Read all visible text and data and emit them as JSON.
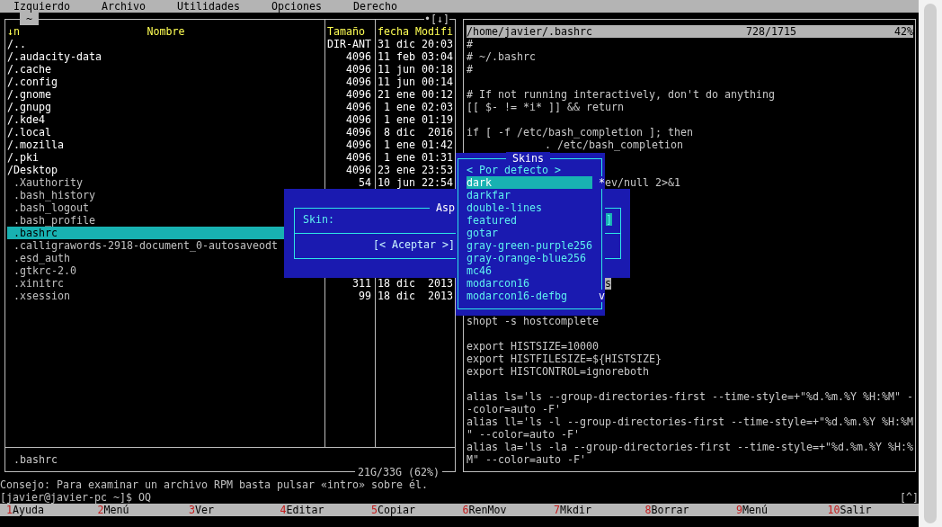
{
  "menu_bar": [
    "Izquierdo",
    "Archivo",
    "Utilidades",
    "Opciones",
    "Derecho"
  ],
  "left_panel": {
    "title": "~",
    "corner": "•[↓]",
    "sort_indicator": "↓n",
    "columns": [
      "Nombre",
      "Tamaño",
      "fecha Modifi"
    ],
    "rows": [
      {
        "name": "/..",
        "kind": "dir",
        "size": "DIR-ANT",
        "date": "31 dic 20:03",
        "selected": false
      },
      {
        "name": "/.audacity-data",
        "kind": "dir",
        "size": "4096",
        "date": "11 feb 03:04",
        "selected": false
      },
      {
        "name": "/.cache",
        "kind": "dir",
        "size": "4096",
        "date": "11 jun 00:18",
        "selected": false
      },
      {
        "name": "/.config",
        "kind": "dir",
        "size": "4096",
        "date": "11 jun 00:14",
        "selected": false
      },
      {
        "name": "/.gnome",
        "kind": "dir",
        "size": "4096",
        "date": "21 ene 00:12",
        "selected": false
      },
      {
        "name": "/.gnupg",
        "kind": "dir",
        "size": "4096",
        "date": "1 ene 02:03",
        "selected": false
      },
      {
        "name": "/.kde4",
        "kind": "dir",
        "size": "4096",
        "date": "1 ene 01:19",
        "selected": false
      },
      {
        "name": "/.local",
        "kind": "dir",
        "size": "4096",
        "date": "8 dic  2016",
        "selected": false
      },
      {
        "name": "/.mozilla",
        "kind": "dir",
        "size": "4096",
        "date": "1 ene 01:42",
        "selected": false
      },
      {
        "name": "/.pki",
        "kind": "dir",
        "size": "4096",
        "date": "1 ene 01:31",
        "selected": false
      },
      {
        "name": "/Desktop",
        "kind": "dir",
        "size": "4096",
        "date": "23 ene 23:53",
        "selected": false
      },
      {
        "name": ".Xauthority",
        "kind": "file",
        "size": "54",
        "date": "10 jun 22:54",
        "selected": false
      },
      {
        "name": ".bash_history",
        "kind": "file",
        "selected": false
      },
      {
        "name": ".bash_logout",
        "kind": "file",
        "selected": false
      },
      {
        "name": ".bash_profile",
        "kind": "file",
        "selected": false
      },
      {
        "name": ".bashrc",
        "kind": "file",
        "selected": true
      },
      {
        "name": ".calligrawords-2918-document_0-autosaveodt",
        "kind": "file",
        "selected": false
      },
      {
        "name": ".esd_auth",
        "kind": "file",
        "selected": false
      },
      {
        "name": ".gtkrc-2.0",
        "kind": "file",
        "selected": false
      },
      {
        "name": ".xinitrc",
        "kind": "file",
        "size": "311",
        "date": "18 dic  2013",
        "selected": false
      },
      {
        "name": ".xsession",
        "kind": "file",
        "size": "99",
        "date": "18 dic  2013",
        "selected": false
      }
    ],
    "mini_status": ".bashrc",
    "disk_usage": "21G/33G (62%)"
  },
  "right_panel": {
    "header": {
      "path": "/home/javier/.bashrc",
      "position": "728/1715",
      "percent": "42%"
    },
    "lines": [
      {
        "kind": "text",
        "text": "#"
      },
      {
        "kind": "text",
        "text": "# ~/.bashrc"
      },
      {
        "kind": "text",
        "text": "#"
      },
      {
        "kind": "blank"
      },
      {
        "kind": "text",
        "text": "# If not running interactively, don't do anything"
      },
      {
        "kind": "text",
        "text": "[[ $- != *i* ]] && return"
      },
      {
        "kind": "blank"
      },
      {
        "kind": "text",
        "text": "if [ -f /etc/bash_completion ]; then"
      },
      {
        "kind": "indented",
        "text": ". /etc/bash_completion"
      },
      {
        "kind": "blank"
      },
      {
        "kind": "blank"
      },
      {
        "kind": "fragment",
        "text": "ev/null 2>&1",
        "highlighted": false
      },
      {
        "kind": "blank"
      },
      {
        "kind": "blank"
      },
      {
        "kind": "blank"
      },
      {
        "kind": "blank"
      },
      {
        "kind": "blank"
      },
      {
        "kind": "blank"
      },
      {
        "kind": "blank"
      },
      {
        "kind": "fragment",
        "text": "s",
        "highlighted": true
      },
      {
        "kind": "blank"
      },
      {
        "kind": "blank"
      },
      {
        "kind": "text",
        "text": "shopt -s hostcomplete"
      },
      {
        "kind": "blank"
      },
      {
        "kind": "text",
        "text": "export HISTSIZE=10000"
      },
      {
        "kind": "text",
        "text": "export HISTFILESIZE=${HISTSIZE}"
      },
      {
        "kind": "text",
        "text": "export HISTCONTROL=ignoreboth"
      },
      {
        "kind": "blank"
      },
      {
        "kind": "text",
        "text": "alias ls='ls --group-directories-first --time-style=+\"%d.%m.%Y %H:%M\" -"
      },
      {
        "kind": "text",
        "text": "-color=auto -F'"
      },
      {
        "kind": "text",
        "text": "alias ll='ls -l --group-directories-first --time-style=+\"%d.%m.%Y %H:%M"
      },
      {
        "kind": "text",
        "text": "\" --color=auto -F'"
      },
      {
        "kind": "text",
        "text": "alias la='ls -la --group-directories-first --time-style=+\"%d.%m.%Y %H:%"
      },
      {
        "kind": "text",
        "text": "M\" --color=auto -F'"
      }
    ]
  },
  "appearance_dialog": {
    "title": "Asp",
    "skin_label": "Skin:",
    "skin_field_end": "]",
    "button": "[< Aceptar >]"
  },
  "skins_dialog": {
    "title": "Skins",
    "scroll_thumb": "*",
    "scroll_down": "v",
    "items": [
      {
        "label": "< Por defecto >",
        "selected": false
      },
      {
        "label": "dark",
        "selected": true
      },
      {
        "label": "darkfar",
        "selected": false
      },
      {
        "label": "double-lines",
        "selected": false
      },
      {
        "label": "featured",
        "selected": false
      },
      {
        "label": "gotar",
        "selected": false
      },
      {
        "label": "gray-green-purple256",
        "selected": false
      },
      {
        "label": "gray-orange-blue256",
        "selected": false
      },
      {
        "label": "mc46",
        "selected": false
      },
      {
        "label": "modarcon16",
        "selected": false
      },
      {
        "label": "modarcon16-defbg",
        "selected": false
      }
    ]
  },
  "hint": "Consejo: Para examinar un archivo RPM basta pulsar «intro» sobre él.",
  "prompt": {
    "text": "[javier@javier-pc ~]$ OQ",
    "corner": "[^]"
  },
  "function_keys": [
    {
      "key": "1",
      "label": "Ayuda"
    },
    {
      "key": "2",
      "label": "Menú"
    },
    {
      "key": "3",
      "label": "Ver"
    },
    {
      "key": "4",
      "label": "Editar"
    },
    {
      "key": "5",
      "label": "Copiar"
    },
    {
      "key": "6",
      "label": "RenMov"
    },
    {
      "key": "7",
      "label": "Mkdir"
    },
    {
      "key": "8",
      "label": "Borrar"
    },
    {
      "key": "9",
      "label": "Menú"
    },
    {
      "key": "10",
      "label": "Salir"
    }
  ]
}
